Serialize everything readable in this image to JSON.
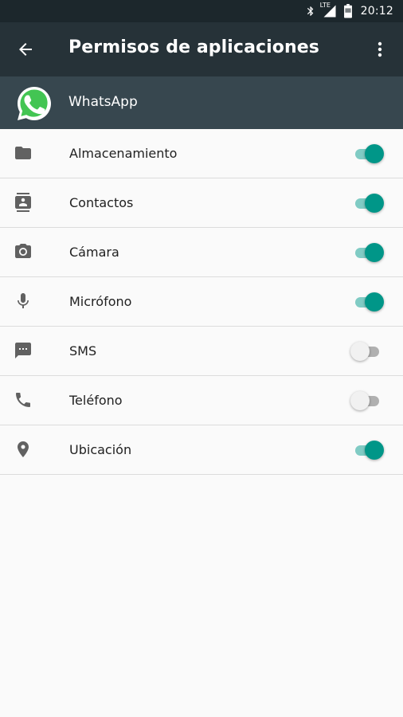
{
  "status_bar": {
    "time": "20:12",
    "network_label": "LTE",
    "icons": [
      "bluetooth-icon",
      "signal-icon",
      "battery-icon"
    ]
  },
  "app_bar": {
    "title": "Permisos de aplicaciones",
    "back_icon": "arrow-back-icon",
    "menu_icon": "more-vert-icon"
  },
  "app": {
    "name": "WhatsApp",
    "icon": "whatsapp-icon"
  },
  "permissions": [
    {
      "label": "Almacenamiento",
      "icon": "folder-icon",
      "enabled": true
    },
    {
      "label": "Contactos",
      "icon": "contacts-icon",
      "enabled": true
    },
    {
      "label": "Cámara",
      "icon": "camera-icon",
      "enabled": true
    },
    {
      "label": "Micrófono",
      "icon": "microphone-icon",
      "enabled": true
    },
    {
      "label": "SMS",
      "icon": "sms-icon",
      "enabled": false
    },
    {
      "label": "Teléfono",
      "icon": "phone-icon",
      "enabled": false
    },
    {
      "label": "Ubicación",
      "icon": "location-icon",
      "enabled": true
    }
  ],
  "colors": {
    "status_bar": "#1c272c",
    "app_bar": "#263238",
    "app_header": "#37474f",
    "accent": "#009688",
    "accent_track": "#80cbc4",
    "background": "#fafafa"
  }
}
